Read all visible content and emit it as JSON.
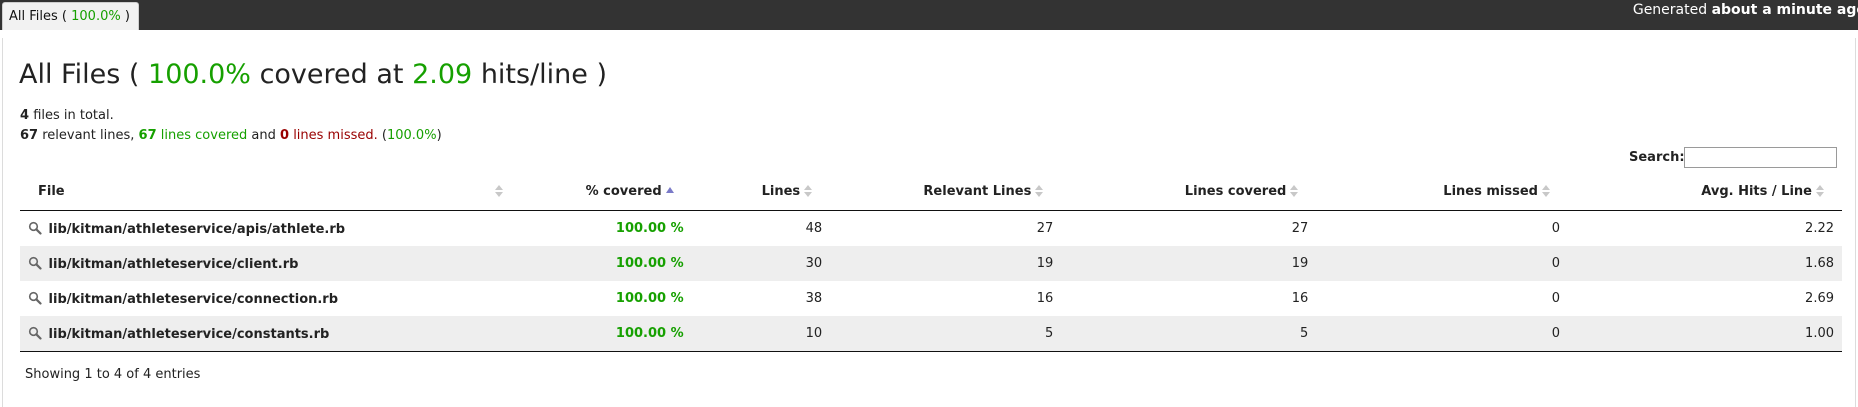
{
  "topbar": {
    "tab_label": "All Files",
    "tab_percent": "100.0%",
    "generated_prefix": "Generated",
    "generated_time": "about a minute ago"
  },
  "header": {
    "title_prefix": "All Files (",
    "title_percent": "100.0%",
    "title_mid": "covered at",
    "title_hits": "2.09",
    "title_suffix": "hits/line )"
  },
  "summary": {
    "files_count": "4",
    "files_text": "files in total.",
    "relevant_count": "67",
    "relevant_text": "relevant lines,",
    "covered_count": "67",
    "covered_text": "lines covered",
    "and_text": "and",
    "missed_count": "0",
    "missed_text": "lines missed.",
    "percent_open": "(",
    "percent": "100.0%",
    "percent_close": ")"
  },
  "search": {
    "label": "Search:",
    "value": "",
    "placeholder": ""
  },
  "table": {
    "columns": [
      "File",
      "% covered",
      "Lines",
      "Relevant Lines",
      "Lines covered",
      "Lines missed",
      "Avg. Hits / Line"
    ],
    "rows": [
      {
        "file": "lib/kitman/athleteservice/apis/athlete.rb",
        "covered": "100.00 %",
        "lines": "48",
        "relevant": "27",
        "lines_covered": "27",
        "missed": "0",
        "avg_hits": "2.22"
      },
      {
        "file": "lib/kitman/athleteservice/client.rb",
        "covered": "100.00 %",
        "lines": "30",
        "relevant": "19",
        "lines_covered": "19",
        "missed": "0",
        "avg_hits": "1.68"
      },
      {
        "file": "lib/kitman/athleteservice/connection.rb",
        "covered": "100.00 %",
        "lines": "38",
        "relevant": "16",
        "lines_covered": "16",
        "missed": "0",
        "avg_hits": "2.69"
      },
      {
        "file": "lib/kitman/athleteservice/constants.rb",
        "covered": "100.00 %",
        "lines": "10",
        "relevant": "5",
        "lines_covered": "5",
        "missed": "0",
        "avg_hits": "1.00"
      }
    ]
  },
  "footer": {
    "info": "Showing 1 to 4 of 4 entries"
  },
  "colors": {
    "covered_green": "#16a000",
    "missed_red": "#990000",
    "topbar_bg": "#333333"
  },
  "icons": {
    "file_row_icon": "magnifier-icon",
    "sort_icon": "sort-arrows-icon",
    "sort_active_icon": "sort-ascending-icon"
  }
}
